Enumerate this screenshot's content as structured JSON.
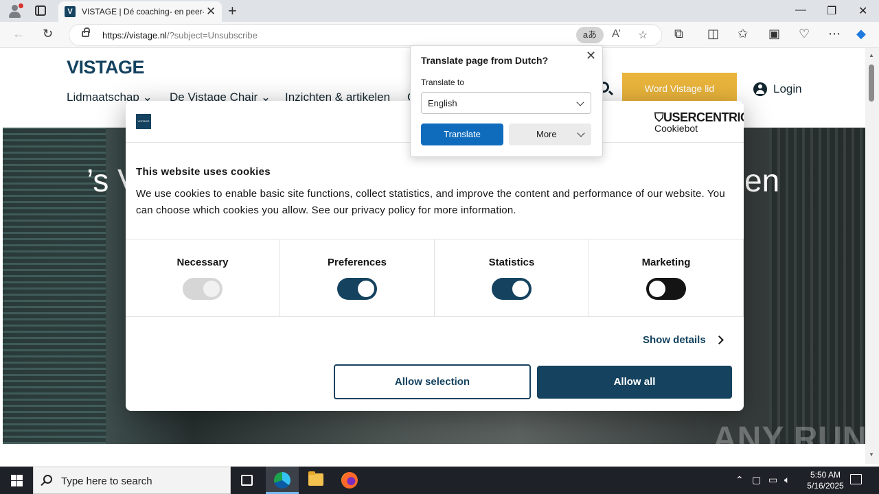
{
  "browser": {
    "tab_title": "VISTAGE | Dé coaching- en peer-a",
    "tab_favicon": "V",
    "url_host": "https://vistage.nl",
    "url_path": "/?subject=Unsubscribe",
    "translate_glyph": "aあ",
    "read_aloud_glyph": "A’"
  },
  "site": {
    "logo": "VISTAGE",
    "nav": [
      "Lidmaatschap",
      "De Vistage Chair",
      "Inzichten & artikelen",
      "C"
    ],
    "cta": "Word Vistage lid",
    "login": "Login",
    "hero_left": "’s V",
    "hero_right": "en"
  },
  "cookie": {
    "logo_text": "VISTAGE",
    "brand": "USERCENTRICS",
    "brand_sub": "Cookiebot",
    "title": "This website uses cookies",
    "body": "We use cookies to enable basic site functions, collect statistics, and improve the content and performance of our website. You can choose which cookies you allow. See our privacy policy for more information.",
    "categories": [
      {
        "label": "Necessary",
        "state": "disabled-on"
      },
      {
        "label": "Preferences",
        "state": "on"
      },
      {
        "label": "Statistics",
        "state": "on"
      },
      {
        "label": "Marketing",
        "state": "off"
      }
    ],
    "show_details": "Show details",
    "allow_selection": "Allow selection",
    "allow_all": "Allow all"
  },
  "translate": {
    "title": "Translate page from Dutch?",
    "label": "Translate to",
    "language": "English",
    "translate_btn": "Translate",
    "more_btn": "More"
  },
  "watermark": "ANY RUN",
  "taskbar": {
    "search_placeholder": "Type here to search",
    "time": "5:50 AM",
    "date": "5/16/2025"
  },
  "colors": {
    "brand_navy": "#14425f",
    "cta_gold": "#e9b43b",
    "translate_blue": "#0f6cbd"
  }
}
